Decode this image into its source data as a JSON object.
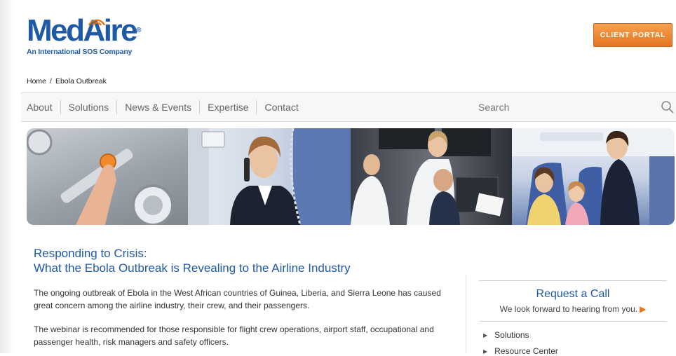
{
  "brand": {
    "logo_text": "MedAire",
    "logo_reg": "®",
    "tagline": "An International SOS Company",
    "accent_color": "#1f5aa6",
    "button_color": "#e4751f"
  },
  "header": {
    "client_portal_label": "CLIENT PORTAL"
  },
  "breadcrumb": {
    "home": "Home",
    "separator": "/",
    "current": "Ebola Outbreak"
  },
  "nav": {
    "items": [
      "About",
      "Solutions",
      "News & Events",
      "Expertise",
      "Contact"
    ],
    "search_placeholder": "Search"
  },
  "banner": {
    "panels": [
      "button-panel-photo",
      "flight-attendant-phone-photo",
      "medical-operations-center-photo",
      "cabin-crew-passengers-photo"
    ]
  },
  "article": {
    "title_line1": "Responding to Crisis:",
    "title_line2": "What the Ebola Outbreak is Revealing to the Airline Industry",
    "paragraph1": "The ongoing outbreak of Ebola in the West African countries of Guinea, Liberia, and Sierra Leone has caused great concern among the airline industry, their crew, and their passengers.",
    "paragraph2": "The webinar is recommended for those responsible for flight crew operations, airport staff, occupational and passenger health, risk managers and safety officers."
  },
  "aside": {
    "title": "Request a Call",
    "subtitle": "We look forward to hearing from you.",
    "links": [
      "Solutions",
      "Resource Center"
    ]
  }
}
